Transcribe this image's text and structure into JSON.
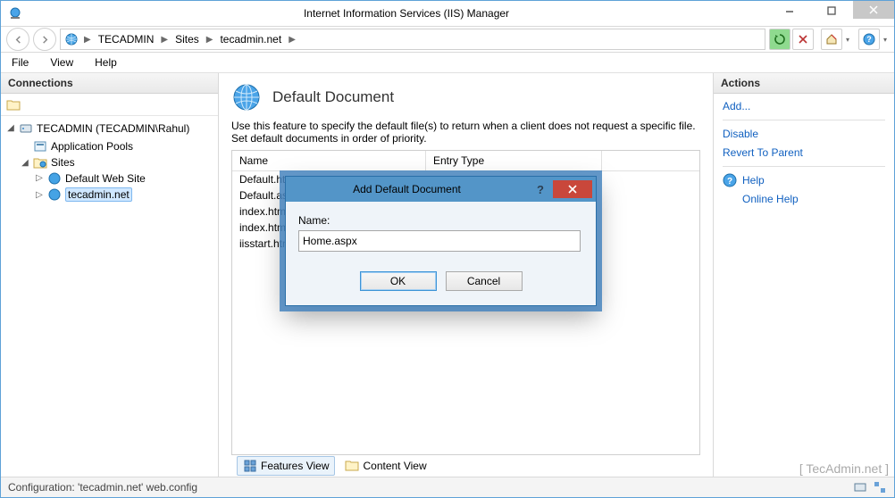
{
  "window": {
    "title": "Internet Information Services (IIS) Manager"
  },
  "breadcrumb": {
    "root_aria": "Start Page",
    "items": [
      "TECADMIN",
      "Sites",
      "tecadmin.net"
    ]
  },
  "menus": {
    "file": "File",
    "view": "View",
    "help": "Help"
  },
  "connections": {
    "header": "Connections",
    "server": "TECADMIN (TECADMIN\\Rahul)",
    "app_pools": "Application Pools",
    "sites_label": "Sites",
    "site_default": "Default Web Site",
    "site_current": "tecadmin.net"
  },
  "page": {
    "title": "Default Document",
    "description": "Use this feature to specify the default file(s) to return when a client does not request a specific file. Set default documents in order of priority.",
    "columns": {
      "name": "Name",
      "type": "Entry Type"
    },
    "rows": [
      "Default.htm",
      "Default.asp",
      "index.htm",
      "index.html",
      "iisstart.htm"
    ]
  },
  "view_tabs": {
    "features": "Features View",
    "content": "Content View"
  },
  "actions": {
    "header": "Actions",
    "add": "Add...",
    "disable": "Disable",
    "revert": "Revert To Parent",
    "help": "Help",
    "online_help": "Online Help"
  },
  "dialog": {
    "title": "Add Default Document",
    "name_label": "Name:",
    "name_value": "Home.aspx",
    "ok": "OK",
    "cancel": "Cancel"
  },
  "status": {
    "config": "Configuration: 'tecadmin.net' web.config"
  },
  "watermark": "[ TecAdmin.net ]"
}
